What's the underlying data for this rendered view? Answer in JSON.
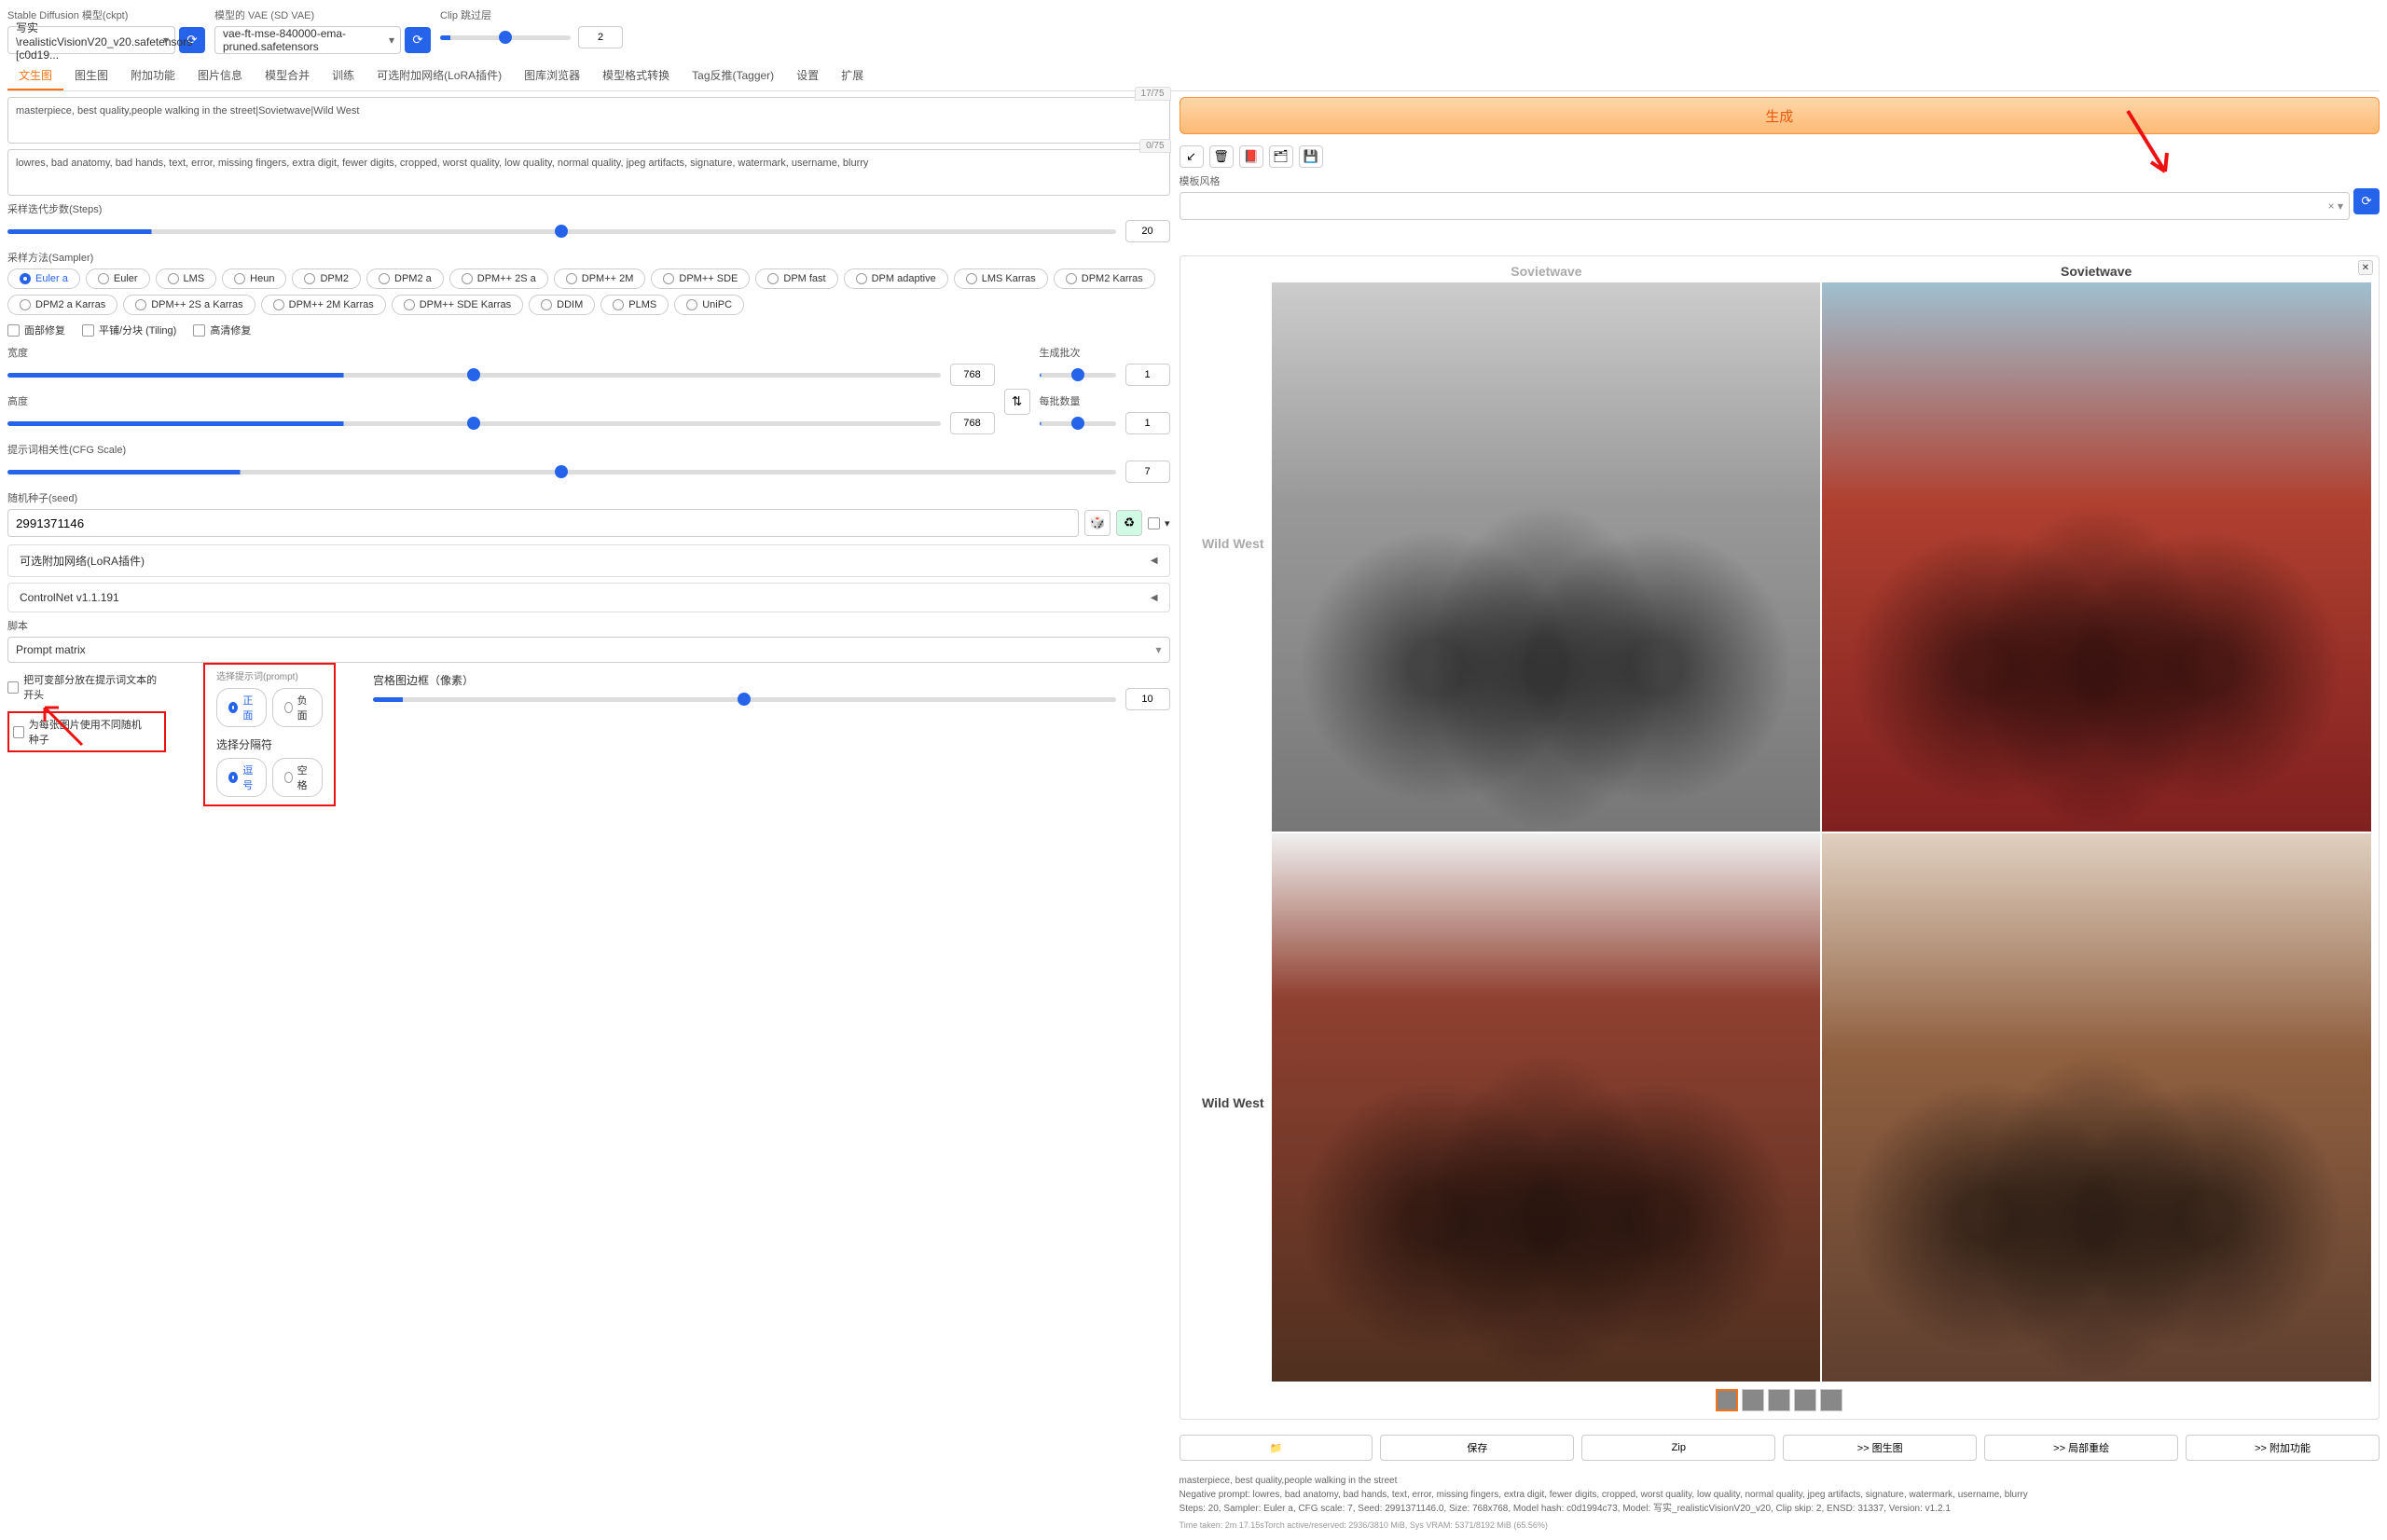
{
  "top": {
    "ckpt_label": "Stable Diffusion 模型(ckpt)",
    "ckpt_value": "写实\\realisticVisionV20_v20.safetensors [c0d19...",
    "vae_label": "模型的 VAE (SD VAE)",
    "vae_value": "vae-ft-mse-840000-ema-pruned.safetensors",
    "clip_label": "Clip 跳过层",
    "clip_value": "2"
  },
  "tabs": [
    "文生图",
    "图生图",
    "附加功能",
    "图片信息",
    "模型合并",
    "训练",
    "可选附加网络(LoRA插件)",
    "图库浏览器",
    "模型格式转换",
    "Tag反推(Tagger)",
    "设置",
    "扩展"
  ],
  "prompt": {
    "positive": "masterpiece, best quality,people walking in the street|Sovietwave|Wild West",
    "positive_count": "17/75",
    "negative": "lowres, bad anatomy, bad hands, text, error, missing fingers, extra digit, fewer digits, cropped, worst quality, low quality, normal quality, jpeg artifacts, signature, watermark, username, blurry",
    "negative_count": "0/75"
  },
  "generate": "生成",
  "style_label": "模板风格",
  "params": {
    "steps_label": "采样迭代步数(Steps)",
    "steps_value": "20",
    "sampler_label": "采样方法(Sampler)",
    "samplers": [
      "Euler a",
      "Euler",
      "LMS",
      "Heun",
      "DPM2",
      "DPM2 a",
      "DPM++ 2S a",
      "DPM++ 2M",
      "DPM++ SDE",
      "DPM fast",
      "DPM adaptive",
      "LMS Karras",
      "DPM2 Karras",
      "DPM2 a Karras",
      "DPM++ 2S a Karras",
      "DPM++ 2M Karras",
      "DPM++ SDE Karras",
      "DDIM",
      "PLMS",
      "UniPC"
    ],
    "face_restore": "面部修复",
    "tiling": "平铺/分块 (Tiling)",
    "hires": "高清修复",
    "width_label": "宽度",
    "width_value": "768",
    "height_label": "高度",
    "height_value": "768",
    "batch_count_label": "生成批次",
    "batch_count_value": "1",
    "batch_size_label": "每批数量",
    "batch_size_value": "1",
    "cfg_label": "提示词相关性(CFG Scale)",
    "cfg_value": "7",
    "seed_label": "随机种子(seed)",
    "seed_value": "2991371146"
  },
  "accordions": {
    "lora": "可选附加网络(LoRA插件)",
    "controlnet": "ControlNet v1.1.191"
  },
  "script": {
    "label": "脚本",
    "value": "Prompt matrix",
    "put_at_start": "把可变部分放在提示词文本的开头",
    "diff_seed": "为每张图片使用不同随机种子",
    "select_prompt_label": "选择提示词(prompt)",
    "opt_positive": "正面",
    "opt_negative": "负面",
    "select_sep_label": "选择分隔符",
    "opt_comma": "逗号",
    "opt_space": "空格",
    "margin_label": "宫格图边框（像素）",
    "margin_value": "10"
  },
  "gallery": {
    "col1": "Sovietwave",
    "col2": "Sovietwave",
    "row1": "Wild West",
    "row2": "Wild West"
  },
  "actions": {
    "folder": "📁",
    "save": "保存",
    "zip": "Zip",
    "img2img": ">> 图生图",
    "inpaint": ">> 局部重绘",
    "extras": ">> 附加功能"
  },
  "info": {
    "l1": "masterpiece, best quality,people walking in the street",
    "l2": "Negative prompt: lowres, bad anatomy, bad hands, text, error, missing fingers, extra digit, fewer digits, cropped, worst quality, low quality, normal quality, jpeg artifacts, signature, watermark, username, blurry",
    "l3": "Steps: 20, Sampler: Euler a, CFG scale: 7, Seed: 2991371146.0, Size: 768x768, Model hash: c0d1994c73, Model: 写实_realisticVisionV20_v20, Clip skip: 2, ENSD: 31337, Version: v1.2.1",
    "l4": "Time taken: 2m 17.15sTorch active/reserved: 2936/3810 MiB, Sys VRAM: 5371/8192 MiB (65.56%)"
  }
}
